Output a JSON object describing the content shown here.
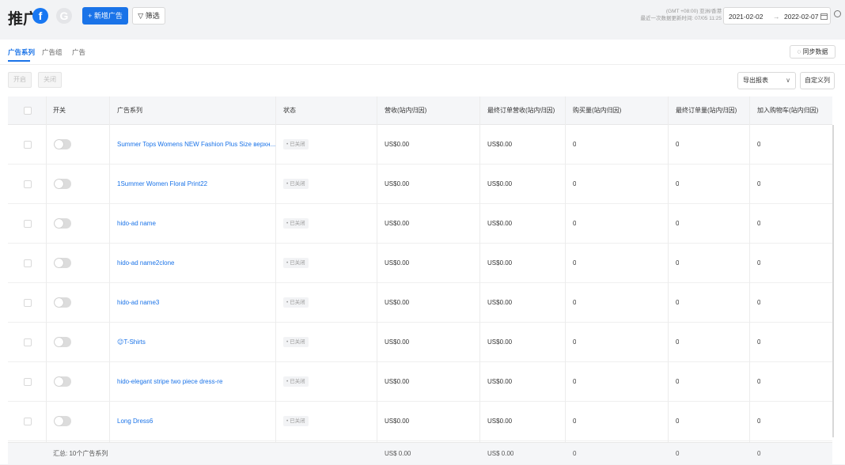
{
  "header": {
    "title": "推广",
    "fb_letter": "f",
    "google_letter": "G",
    "add_button": "+ 新增广告",
    "filter_button": "▽ 筛选",
    "timezone": "(GMT +08:00) 亚洲/香港",
    "last_update": "最近一次数据更新时间: 07/05 11:25",
    "date_start": "2021-02-02",
    "date_arrow": "→",
    "date_end": "2022-02-07",
    "calendar_icon": "calendar-icon",
    "clock_icon": "clock-icon"
  },
  "tabs": [
    {
      "label": "广告系列",
      "active": true
    },
    {
      "label": "广告组",
      "active": false
    },
    {
      "label": "广告",
      "active": false
    }
  ],
  "toolbar": {
    "sync_label": "◌ 同步数据",
    "on_label": "开启",
    "off_label": "关闭",
    "export_label": "导出报表",
    "export_chevron": "∨",
    "custom_label": "自定义列"
  },
  "columns": [
    "开关",
    "广告系列",
    "状态",
    "营收(站内归因)",
    "最终订单营收(站内归因)",
    "购买量(站内归因)",
    "最终订单量(站内归因)",
    "加入购物车(站内归因)"
  ],
  "rows": [
    {
      "name": "Summer Tops Womens NEW Fashion Plus Size верхн...",
      "status": "• 已关闭",
      "revenue": "US$0.00",
      "final_revenue": "US$0.00",
      "purchases": "0",
      "final_orders": "0",
      "add_to_cart": "0"
    },
    {
      "name": "1Summer Women Floral Print22",
      "status": "• 已关闭",
      "revenue": "US$0.00",
      "final_revenue": "US$0.00",
      "purchases": "0",
      "final_orders": "0",
      "add_to_cart": "0"
    },
    {
      "name": "hido-ad name",
      "status": "• 已关闭",
      "revenue": "US$0.00",
      "final_revenue": "US$0.00",
      "purchases": "0",
      "final_orders": "0",
      "add_to_cart": "0"
    },
    {
      "name": "hido-ad name2clone",
      "status": "• 已关闭",
      "revenue": "US$0.00",
      "final_revenue": "US$0.00",
      "purchases": "0",
      "final_orders": "0",
      "add_to_cart": "0"
    },
    {
      "name": "hido-ad name3",
      "status": "• 已关闭",
      "revenue": "US$0.00",
      "final_revenue": "US$0.00",
      "purchases": "0",
      "final_orders": "0",
      "add_to_cart": "0"
    },
    {
      "name": "😉T-Shirts",
      "status": "• 已关闭",
      "revenue": "US$0.00",
      "final_revenue": "US$0.00",
      "purchases": "0",
      "final_orders": "0",
      "add_to_cart": "0"
    },
    {
      "name": "hido-elegant stripe two piece dress-re",
      "status": "• 已关闭",
      "revenue": "US$0.00",
      "final_revenue": "US$0.00",
      "purchases": "0",
      "final_orders": "0",
      "add_to_cart": "0"
    },
    {
      "name": "Long Dress6",
      "status": "• 已关闭",
      "revenue": "US$0.00",
      "final_revenue": "US$0.00",
      "purchases": "0",
      "final_orders": "0",
      "add_to_cart": "0"
    }
  ],
  "footer": {
    "summary": "汇总: 10个广告系列",
    "revenue": "US$ 0.00",
    "final_revenue": "US$ 0.00",
    "purchases": "0",
    "final_orders": "0",
    "add_to_cart": "0"
  }
}
